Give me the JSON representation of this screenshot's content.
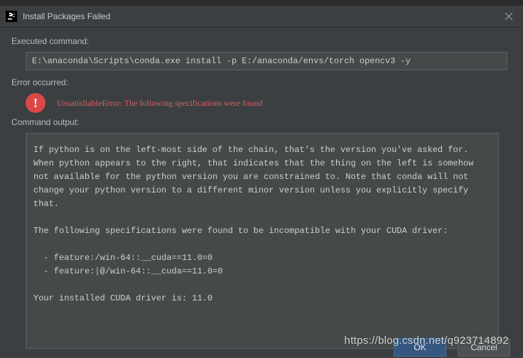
{
  "titlebar": {
    "title": "Install Packages Failed"
  },
  "labels": {
    "executed": "Executed command:",
    "error": "Error occurred:",
    "output": "Command output:"
  },
  "command": "E:\\anaconda\\Scripts\\conda.exe install -p E:/anaconda/envs/torch opencv3 -y",
  "error_message": "UnsatisfiableError: The following specifications were found",
  "output": "If python is on the left-most side of the chain, that's the version you've asked for.\nWhen python appears to the right, that indicates that the thing on the left is somehow\nnot available for the python version you are constrained to. Note that conda will not\nchange your python version to a different minor version unless you explicitly specify\nthat.\n\nThe following specifications were found to be incompatible with your CUDA driver:\n\n  - feature:/win-64::__cuda==11.0=0\n  - feature:|@/win-64::__cuda==11.0=0\n\nYour installed CUDA driver is: 11.0",
  "buttons": {
    "ok": "OK",
    "cancel": "Cancel"
  },
  "watermark": "https://blog.csdn.net/q923714892"
}
